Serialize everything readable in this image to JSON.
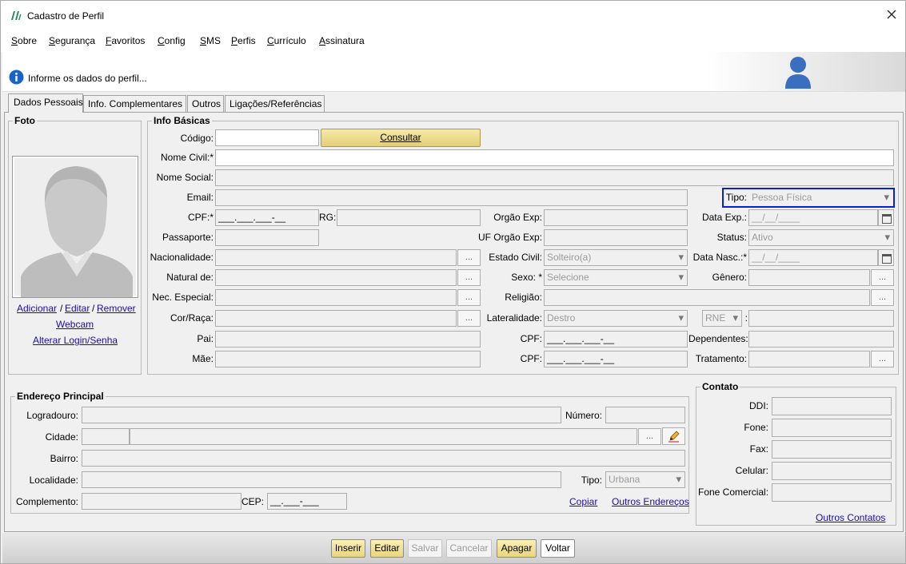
{
  "window": {
    "title": "Cadastro de Perfil"
  },
  "menu": [
    "Sobre",
    "Segurança",
    "Favoritos",
    "Config",
    "SMS",
    "Perfis",
    "Currículo",
    "Assinatura"
  ],
  "info": {
    "message": "Informe os dados do perfil..."
  },
  "tabs": [
    "Dados Pessoais",
    "Info. Complementares",
    "Outros",
    "Ligações/Referências"
  ],
  "foto": {
    "legend": "Foto",
    "add": "Adicionar",
    "sep1": "/",
    "edit": "Editar",
    "sep2": "/",
    "remove": "Remover",
    "webcam": "Webcam",
    "login": "Alterar Login/Senha"
  },
  "basic": {
    "legend": "Info Básicas",
    "codigo_label": "Código:",
    "consultar": "Consultar",
    "nome_civil_label": "Nome Civil:*",
    "nome_social_label": "Nome Social:",
    "email_label": "Email:",
    "tipo_label": "Tipo:",
    "tipo_value": "Pessoa Física",
    "cpf_label": "CPF:*",
    "cpf_mask": "___.___.___-__",
    "rg_label": "RG:",
    "orgao_label": "Orgão Exp:",
    "data_exp_label": "Data Exp.:",
    "date_mask": "__/__/____",
    "passaporte_label": "Passaporte:",
    "uf_orgao_label": "UF Orgão Exp:",
    "status_label": "Status:",
    "status_value": "Ativo",
    "nacionalidade_label": "Nacionalidade:",
    "estado_civil_label": "Estado Civil:",
    "estado_civil_value": "Solteiro(a)",
    "data_nasc_label": "Data Nasc.:*",
    "natural_label": "Natural de:",
    "sexo_label": "Sexo: *",
    "sexo_value": "Selecione",
    "genero_label": "Gênero:",
    "nec_label": "Nec. Especial:",
    "religiao_label": "Religião:",
    "cor_label": "Cor/Raça:",
    "lateralidade_label": "Lateralidade:",
    "lateralidade_value": "Destro",
    "rne_value": "RNE",
    "colon": ":",
    "pai_label": "Pai:",
    "pai_cpf_label": "CPF:",
    "dependentes_label": "Dependentes:",
    "mae_label": "Mãe:",
    "mae_cpf_label": "CPF:",
    "tratamento_label": "Tratamento:",
    "dots": "..."
  },
  "address": {
    "legend": "Endereço Principal",
    "logradouro_label": "Logradouro:",
    "numero_label": "Número:",
    "cidade_label": "Cidade:",
    "bairro_label": "Bairro:",
    "localidade_label": "Localidade:",
    "tipo_label": "Tipo:",
    "tipo_value": "Urbana",
    "complemento_label": "Complemento:",
    "cep_label": "CEP:",
    "cep_mask": "__.___-___",
    "copiar": "Copiar",
    "outros": "Outros Endereços"
  },
  "contact": {
    "legend": "Contato",
    "ddi_label": "DDI:",
    "fone_label": "Fone:",
    "fax_label": "Fax:",
    "celular_label": "Celular:",
    "fone_com_label": "Fone Comercial:",
    "outros": "Outros Contatos"
  },
  "buttons": {
    "inserir": "Inserir",
    "editar": "Editar",
    "salvar": "Salvar",
    "cancelar": "Cancelar",
    "apagar": "Apagar",
    "voltar": "Voltar"
  },
  "colors": {
    "highlight_border": "#0a1fd0",
    "link": "#1a0dab",
    "button_yellow": "#efdf96",
    "info_blue": "#1b63c4"
  }
}
